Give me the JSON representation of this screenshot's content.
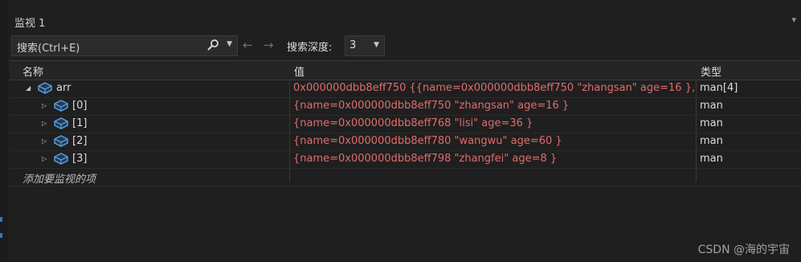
{
  "window": {
    "title": "监视 1",
    "menu_glyph": "▾"
  },
  "toolbar": {
    "search_placeholder": "搜索(Ctrl+E)",
    "search_icon": "search-icon",
    "back_glyph": "←",
    "forward_glyph": "→",
    "depth_label": "搜索深度:",
    "depth_value": "3"
  },
  "columns": {
    "name": "名称",
    "value": "值",
    "type": "类型"
  },
  "rows": [
    {
      "name": "arr",
      "value": "0x000000dbb8eff750 {{name=0x000000dbb8eff750 \"zhangsan\" age=16 }, ...",
      "type": "man[4]",
      "expanded": true,
      "level": 0
    },
    {
      "name": "[0]",
      "value": "{name=0x000000dbb8eff750 \"zhangsan\" age=16 }",
      "type": "man",
      "expanded": false,
      "level": 1
    },
    {
      "name": "[1]",
      "value": "{name=0x000000dbb8eff768 \"lisi\" age=36 }",
      "type": "man",
      "expanded": false,
      "level": 1
    },
    {
      "name": "[2]",
      "value": "{name=0x000000dbb8eff780 \"wangwu\" age=60 }",
      "type": "man",
      "expanded": false,
      "level": 1
    },
    {
      "name": "[3]",
      "value": "{name=0x000000dbb8eff798 \"zhangfei\" age=8 }",
      "type": "man",
      "expanded": false,
      "level": 1
    }
  ],
  "add_watch_label": "添加要监视的项",
  "watermark": "CSDN @海的宇宙",
  "colors": {
    "background": "#1f1f1f",
    "value_text": "#e06c6c",
    "icon_blue": "#5b9bd5"
  }
}
